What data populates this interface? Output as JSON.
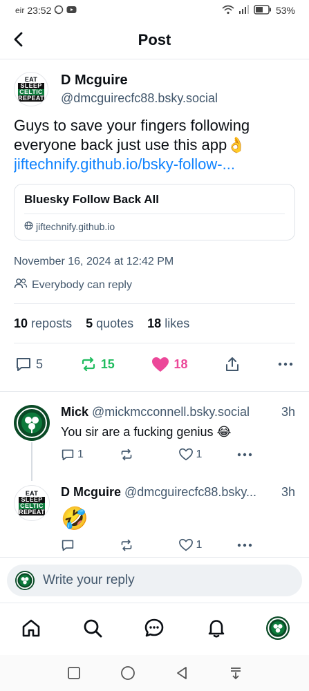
{
  "status_bar": {
    "carrier": "eir",
    "time": "23:52",
    "battery": "53%"
  },
  "header": {
    "title": "Post"
  },
  "post": {
    "author_name": "D Mcguire",
    "author_handle": "@dmcguirecfc88.bsky.social",
    "avatar_lines": [
      "EAT",
      "SLEEP",
      "CELTIC",
      "REPEAT"
    ],
    "text": "Guys to save your fingers following everyone back just use this app👌",
    "link": "jiftechnify.github.io/bsky-follow-...",
    "card": {
      "title": "Bluesky Follow Back All",
      "domain": "jiftechnify.github.io"
    },
    "date": "November 16, 2024 at 12:42 PM",
    "reply_setting": "Everybody can reply",
    "stats": {
      "reposts_count": "10",
      "reposts_label": "reposts",
      "quotes_count": "5",
      "quotes_label": "quotes",
      "likes_count": "18",
      "likes_label": "likes"
    },
    "actions": {
      "replies": "5",
      "reposts": "15",
      "likes": "18"
    },
    "colors": {
      "repost": "#20bc5f",
      "like": "#ec4899",
      "link": "#1083fe"
    }
  },
  "replies": [
    {
      "name": "Mick",
      "handle": "@mickmcconnell.bsky.social",
      "time": "3h",
      "text": "You sir are a fucking genius 😂",
      "reply_count": "1",
      "like_count": "1"
    },
    {
      "name": "D Mcguire",
      "handle": "@dmcguirecfc88.bsky...",
      "time": "3h",
      "text": "🤣",
      "like_count": "1"
    }
  ],
  "composer": {
    "placeholder": "Write your reply"
  },
  "nav": [
    "home-icon",
    "search-icon",
    "chat-icon",
    "bell-icon",
    "profile-avatar"
  ]
}
